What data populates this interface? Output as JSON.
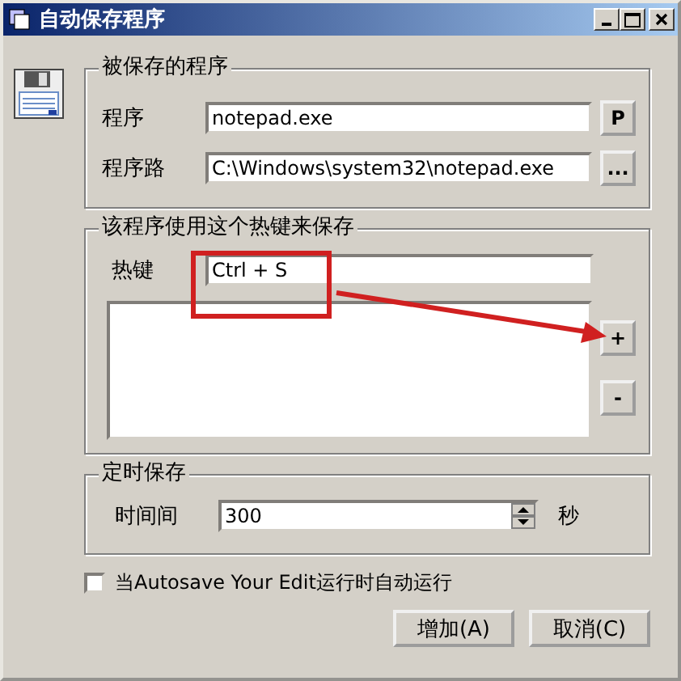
{
  "window": {
    "title": "自动保存程序"
  },
  "program": {
    "legend": "被保存的程序",
    "name_label": "程序",
    "name_value": "notepad.exe",
    "pick_button": "P",
    "path_label": "程序路",
    "path_value": "C:\\Windows\\system32\\notepad.exe",
    "browse_button": "..."
  },
  "hotkey": {
    "legend": "该程序使用这个热键来保存",
    "label": "热键",
    "value": "Ctrl + S",
    "add_button": "+",
    "remove_button": "-"
  },
  "timer": {
    "legend": "定时保存",
    "label": "时间间",
    "value": "300",
    "unit": "秒"
  },
  "autostart": {
    "label": "当Autosave Your Edit运行时自动运行",
    "checked": false
  },
  "buttons": [
    "增加(A)",
    "取消(C)"
  ]
}
